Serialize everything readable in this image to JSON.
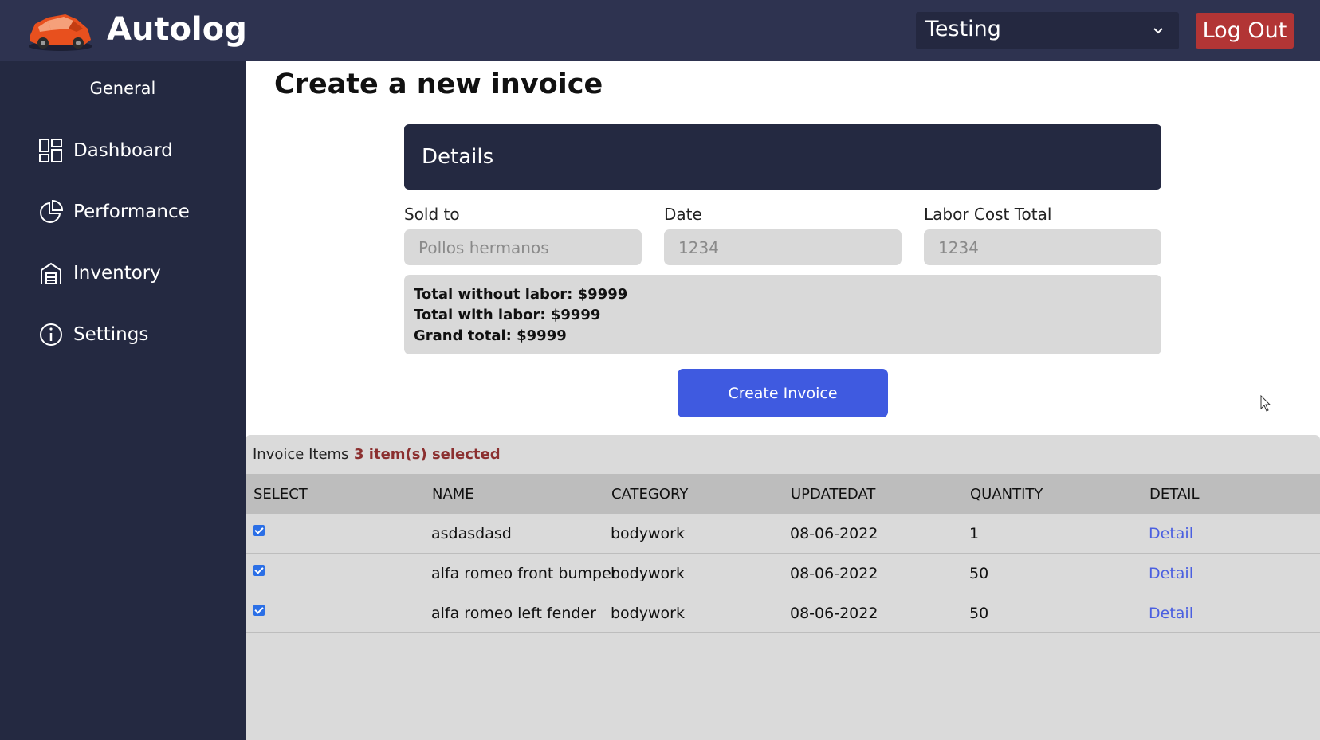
{
  "header": {
    "brand": "Autolog",
    "workspace_selected": "Testing",
    "logout_label": "Log Out",
    "icons": [
      "car-logo",
      "chevron-down-icon"
    ]
  },
  "sidebar": {
    "heading": "General",
    "items": [
      {
        "label": "Dashboard",
        "icon": "dashboard-icon"
      },
      {
        "label": "Performance",
        "icon": "pie-chart-icon"
      },
      {
        "label": "Inventory",
        "icon": "warehouse-icon"
      },
      {
        "label": "Settings",
        "icon": "info-icon"
      }
    ]
  },
  "main": {
    "title": "Create a new invoice",
    "details_title": "Details",
    "fields": [
      {
        "label": "Sold to",
        "placeholder": "Pollos hermanos"
      },
      {
        "label": "Date",
        "placeholder": "1234"
      },
      {
        "label": "Labor Cost Total",
        "placeholder": "1234"
      }
    ],
    "totals": {
      "without_labor": "Total without labor: $9999",
      "with_labor": "Total with labor: $9999",
      "grand": "Grand total: $9999"
    },
    "create_label": "Create Invoice"
  },
  "items": {
    "title": "Invoice Items",
    "selected_text": "3 item(s) selected",
    "columns": [
      "SELECT",
      "NAME",
      "CATEGORY",
      "UPDATEDAT",
      "QUANTITY",
      "DETAIL"
    ],
    "rows": [
      {
        "checked": true,
        "name": "asdasdasd",
        "category": "bodywork",
        "updated": "08-06-2022",
        "quantity": "1",
        "detail": "Detail"
      },
      {
        "checked": true,
        "name": "alfa romeo front bumper",
        "category": "bodywork",
        "updated": "08-06-2022",
        "quantity": "50",
        "detail": "Detail"
      },
      {
        "checked": true,
        "name": "alfa romeo left fender",
        "category": "bodywork",
        "updated": "08-06-2022",
        "quantity": "50",
        "detail": "Detail"
      }
    ]
  },
  "colors": {
    "topbar": "#2e3350",
    "sidebar": "#242941",
    "accent_button": "#3f5ae0",
    "logout": "#b23535",
    "selected_text": "#8b2f2f"
  }
}
